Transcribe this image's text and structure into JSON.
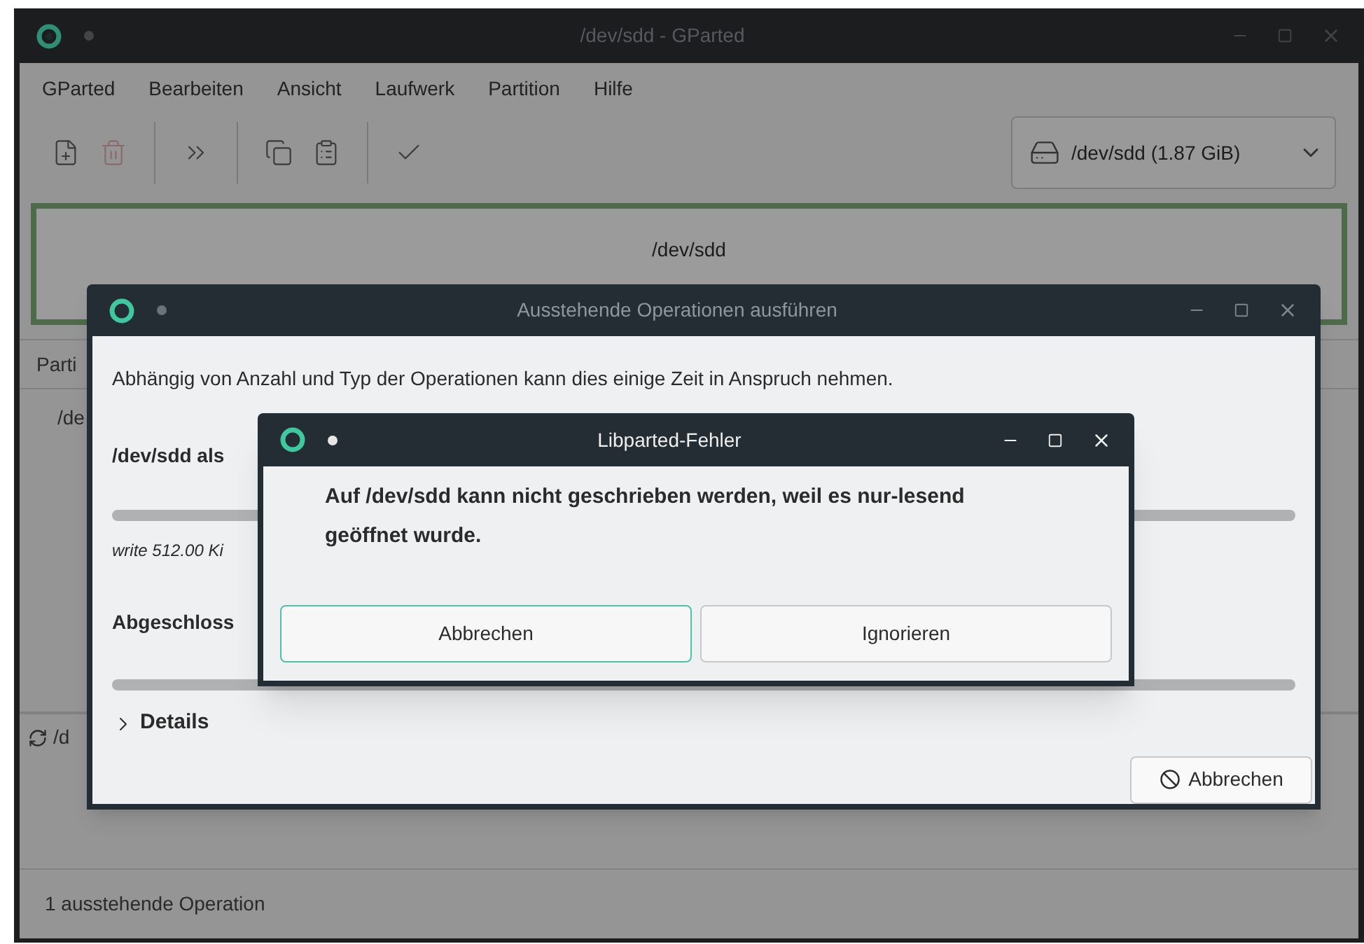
{
  "window": {
    "title": "/dev/sdd - GParted"
  },
  "menu": [
    "GParted",
    "Bearbeiten",
    "Ansicht",
    "Laufwerk",
    "Partition",
    "Hilfe"
  ],
  "toolbar": [
    {
      "kind": "new",
      "disabled": false
    },
    {
      "kind": "delete",
      "disabled": true
    },
    {
      "kind": "sep"
    },
    {
      "kind": "resize",
      "disabled": false
    },
    {
      "kind": "sep"
    },
    {
      "kind": "copy",
      "disabled": false
    },
    {
      "kind": "paste",
      "disabled": false
    },
    {
      "kind": "sep"
    },
    {
      "kind": "apply",
      "disabled": false
    }
  ],
  "device_selector": {
    "value": "/dev/sdd (1.87 GiB)"
  },
  "disk_map": {
    "name": "/dev/sdd"
  },
  "partition_table": {
    "column_1": "Parti",
    "rows": [
      "/de"
    ]
  },
  "operations_pane": {
    "items": [
      "/d"
    ]
  },
  "status_bar": "1 ausstehende Operation",
  "apply_dialog": {
    "title": "Ausstehende Operationen ausführen",
    "info": "Abhängig von Anzahl und Typ der Operationen kann dies einige Zeit in Anspruch nehmen.",
    "operation": "/dev/sdd als",
    "step": "write 512.00 Ki",
    "completed": "Abgeschloss",
    "details": {
      "label": "Details",
      "expanded": false
    },
    "cancel": "Abbrechen"
  },
  "error_dialog": {
    "title": "Libparted-Fehler",
    "message": "Auf /dev/sdd kann nicht geschrieben werden, weil es nur-lesend geöffnet wurde.",
    "buttons": [
      {
        "label": "Abbrechen",
        "focused": true
      },
      {
        "label": "Ignorieren",
        "focused": false
      }
    ]
  }
}
